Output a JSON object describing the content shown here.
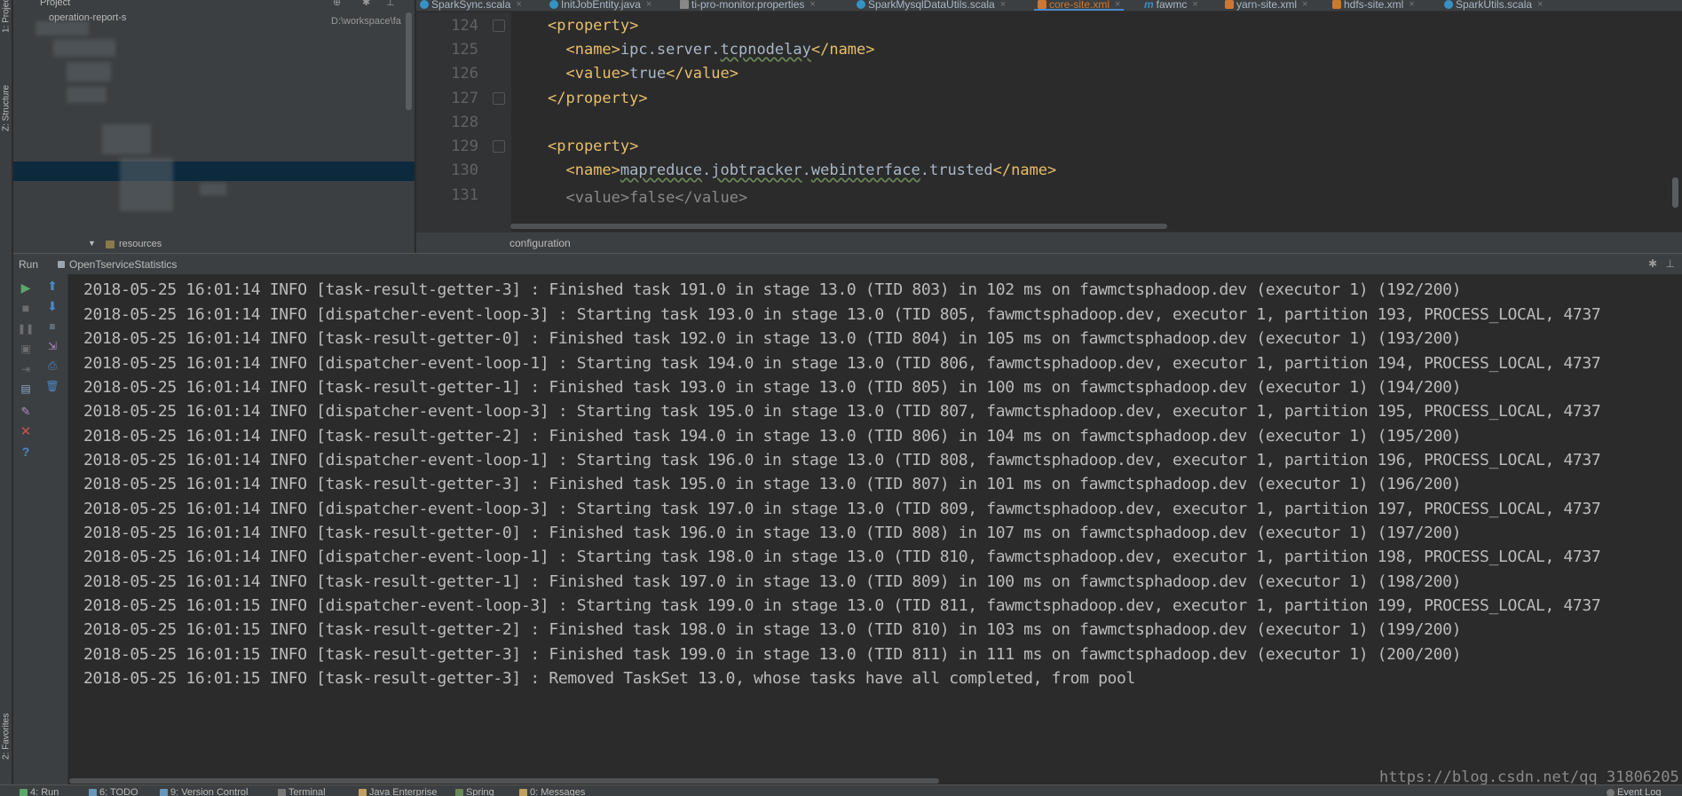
{
  "left_strip": {
    "tabs": [
      "1: Project",
      "Z: Structure",
      "2: Favorites"
    ]
  },
  "project_panel": {
    "title": "Project",
    "row_module": "operation-report-s",
    "row_path": "D:\\workspace\\fa",
    "row_resources": "resources"
  },
  "editor_tabs": [
    {
      "label": "SparkSync.scala",
      "icon": "scala",
      "active": false
    },
    {
      "label": "InitJobEntity.java",
      "icon": "class",
      "active": false
    },
    {
      "label": "ti-pro-monitor.properties",
      "icon": "properties",
      "active": false
    },
    {
      "label": "SparkMysqlDataUtils.scala",
      "icon": "scala",
      "active": false
    },
    {
      "label": "core-site.xml",
      "icon": "xml",
      "active": true
    },
    {
      "label": "fawmc",
      "icon": "maven",
      "active": false
    },
    {
      "label": "yarn-site.xml",
      "icon": "xml",
      "active": false
    },
    {
      "label": "hdfs-site.xml",
      "icon": "xml",
      "active": false
    },
    {
      "label": "SparkUtils.scala",
      "icon": "scala",
      "active": false
    }
  ],
  "editor": {
    "line_numbers": [
      "124",
      "125",
      "126",
      "127",
      "128",
      "129",
      "130",
      "131"
    ],
    "lines": {
      "l124": {
        "open": "<property>"
      },
      "l125": {
        "open": "<name>",
        "text_a": "ipc.server.",
        "text_b": "tcpnodelay",
        "close": "</name>"
      },
      "l126": {
        "open": "<value>",
        "text": "true",
        "close": "</value>"
      },
      "l127": {
        "close": "</property>"
      },
      "l129": {
        "open": "<property>"
      },
      "l130": {
        "open": "<name>",
        "w1": "mapreduce",
        "w2": "jobtracker",
        "w3": "webinterface",
        "w4": "trusted",
        "close": "</name>"
      },
      "l131": {
        "text": "<value>false</value>"
      }
    }
  },
  "breadcrumb": "configuration",
  "run_panel": {
    "label": "Run",
    "config_name": "OpenTserviceStatistics"
  },
  "console_lines": [
    "2018-05-25 16:01:14 INFO [task-result-getter-3] : Finished task 191.0 in stage 13.0 (TID 803) in 102 ms on fawmctsphadoop.dev (executor 1) (192/200)",
    "2018-05-25 16:01:14 INFO [dispatcher-event-loop-3] : Starting task 193.0 in stage 13.0 (TID 805, fawmctsphadoop.dev, executor 1, partition 193, PROCESS_LOCAL, 4737",
    "2018-05-25 16:01:14 INFO [task-result-getter-0] : Finished task 192.0 in stage 13.0 (TID 804) in 105 ms on fawmctsphadoop.dev (executor 1) (193/200)",
    "2018-05-25 16:01:14 INFO [dispatcher-event-loop-1] : Starting task 194.0 in stage 13.0 (TID 806, fawmctsphadoop.dev, executor 1, partition 194, PROCESS_LOCAL, 4737",
    "2018-05-25 16:01:14 INFO [task-result-getter-1] : Finished task 193.0 in stage 13.0 (TID 805) in 100 ms on fawmctsphadoop.dev (executor 1) (194/200)",
    "2018-05-25 16:01:14 INFO [dispatcher-event-loop-3] : Starting task 195.0 in stage 13.0 (TID 807, fawmctsphadoop.dev, executor 1, partition 195, PROCESS_LOCAL, 4737",
    "2018-05-25 16:01:14 INFO [task-result-getter-2] : Finished task 194.0 in stage 13.0 (TID 806) in 104 ms on fawmctsphadoop.dev (executor 1) (195/200)",
    "2018-05-25 16:01:14 INFO [dispatcher-event-loop-1] : Starting task 196.0 in stage 13.0 (TID 808, fawmctsphadoop.dev, executor 1, partition 196, PROCESS_LOCAL, 4737",
    "2018-05-25 16:01:14 INFO [task-result-getter-3] : Finished task 195.0 in stage 13.0 (TID 807) in 101 ms on fawmctsphadoop.dev (executor 1) (196/200)",
    "2018-05-25 16:01:14 INFO [dispatcher-event-loop-3] : Starting task 197.0 in stage 13.0 (TID 809, fawmctsphadoop.dev, executor 1, partition 197, PROCESS_LOCAL, 4737",
    "2018-05-25 16:01:14 INFO [task-result-getter-0] : Finished task 196.0 in stage 13.0 (TID 808) in 107 ms on fawmctsphadoop.dev (executor 1) (197/200)",
    "2018-05-25 16:01:14 INFO [dispatcher-event-loop-1] : Starting task 198.0 in stage 13.0 (TID 810, fawmctsphadoop.dev, executor 1, partition 198, PROCESS_LOCAL, 4737",
    "2018-05-25 16:01:14 INFO [task-result-getter-1] : Finished task 197.0 in stage 13.0 (TID 809) in 100 ms on fawmctsphadoop.dev (executor 1) (198/200)",
    "2018-05-25 16:01:15 INFO [dispatcher-event-loop-3] : Starting task 199.0 in stage 13.0 (TID 811, fawmctsphadoop.dev, executor 1, partition 199, PROCESS_LOCAL, 4737",
    "2018-05-25 16:01:15 INFO [task-result-getter-2] : Finished task 198.0 in stage 13.0 (TID 810) in 103 ms on fawmctsphadoop.dev (executor 1) (199/200)",
    "2018-05-25 16:01:15 INFO [task-result-getter-3] : Finished task 199.0 in stage 13.0 (TID 811) in 111 ms on fawmctsphadoop.dev (executor 1) (200/200)",
    "2018-05-25 16:01:15 INFO [task-result-getter-3] : Removed TaskSet 13.0, whose tasks have all completed, from pool"
  ],
  "watermark": "https://blog.csdn.net/qq_31806205",
  "bottom_tabs": [
    "4: Run",
    "6: TODO",
    "9: Version Control",
    "Terminal",
    "Java Enterprise",
    "Spring",
    "0: Messages",
    "Event Log"
  ],
  "colors": {
    "accent": "#4a88c7",
    "active_tab_text": "#cc7832",
    "xml_tag": "#e8bf6a",
    "run_green": "#59a869",
    "stop_red": "#c75450"
  }
}
